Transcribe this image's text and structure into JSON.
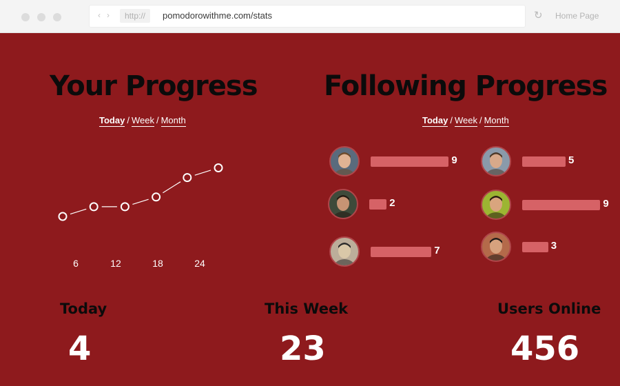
{
  "browser": {
    "protocol": "http://",
    "url": "pomodorowithme.com/stats",
    "home_label": "Home Page",
    "back_icon": "chevron-left-icon",
    "forward_icon": "chevron-right-icon",
    "reload_icon": "reload-icon"
  },
  "your_progress": {
    "title": "Your Progress",
    "periods": {
      "today": "Today",
      "week": "Week",
      "month": "Month",
      "separator": "/",
      "active": "today"
    },
    "chart_data": {
      "type": "line",
      "x_ticks": [
        "6",
        "12",
        "18",
        "24"
      ],
      "values": [
        0,
        1,
        1,
        2,
        4,
        5
      ],
      "marker": "open-circle",
      "grid": false,
      "line_color": "#ffffff"
    }
  },
  "following_progress": {
    "title": "Following Progress",
    "periods": {
      "today": "Today",
      "week": "Week",
      "month": "Month",
      "separator": "/",
      "active": "today"
    },
    "bar_color": "#d66266",
    "max_count": 9,
    "friends": [
      {
        "count": "9",
        "value": 9,
        "avatar_bg": "#5a6b7d",
        "skin": "#e0b394",
        "hair": "#6b4a2c"
      },
      {
        "count": "2",
        "value": 2,
        "avatar_bg": "#3e4a3a",
        "skin": "#c79474",
        "hair": "#241a12"
      },
      {
        "count": "7",
        "value": 7,
        "avatar_bg": "#bcae9a",
        "skin": "#d9c8a8",
        "hair": "#2a2a2a"
      },
      {
        "count": "5",
        "value": 5,
        "avatar_bg": "#8a9aaa",
        "skin": "#d8a98a",
        "hair": "#4a3828"
      },
      {
        "count": "9",
        "value": 9,
        "avatar_bg": "#9cb532",
        "skin": "#d9a57e",
        "hair": "#2a1c10"
      },
      {
        "count": "3",
        "value": 3,
        "avatar_bg": "#b46a4a",
        "skin": "#d6a27e",
        "hair": "#1e1a18"
      }
    ]
  },
  "stats": {
    "today_label": "Today",
    "today_value": "4",
    "week_label": "This Week",
    "week_value": "23",
    "online_label": "Users Online",
    "online_value": "456"
  },
  "colors": {
    "background": "#8e1a1d",
    "heading": "#0b0b0b",
    "text": "#ffffff"
  }
}
